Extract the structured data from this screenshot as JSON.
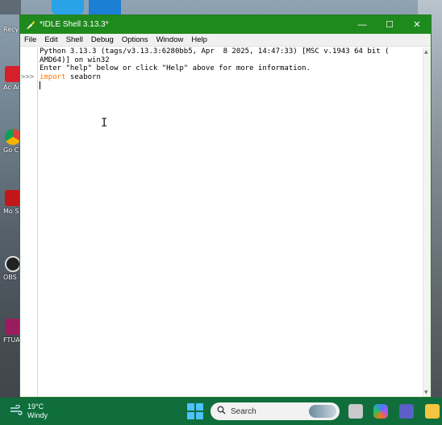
{
  "window": {
    "title": "*IDLE Shell 3.13.3*",
    "controls": {
      "minimize": "—",
      "maximize": "☐",
      "close": "✕"
    }
  },
  "menu": [
    "File",
    "Edit",
    "Shell",
    "Debug",
    "Options",
    "Window",
    "Help"
  ],
  "shell": {
    "prompt": ">>>",
    "banner_line1": "Python 3.13.3 (tags/v3.13.3:6280bb5, Apr  8 2025, 14:47:33) [MSC v.1943 64 bit (",
    "banner_line2": "AMD64)] on win32",
    "banner_line3": "Enter \"help\" below or click \"Help\" above for more information.",
    "input_keyword": "import",
    "input_rest": " seaborn"
  },
  "desktop_icons": [
    "Recy",
    "Ac Ac",
    "Go Ch",
    "Mo Secu",
    "OBS",
    "FTUA"
  ],
  "taskbar": {
    "weather_temp": "19°C",
    "weather_condition": "Windy",
    "search_placeholder": "Search"
  },
  "colors": {
    "titlebar": "#1e8a1e",
    "taskbar": "#0f6e3c",
    "keyword": "#ff7700"
  }
}
